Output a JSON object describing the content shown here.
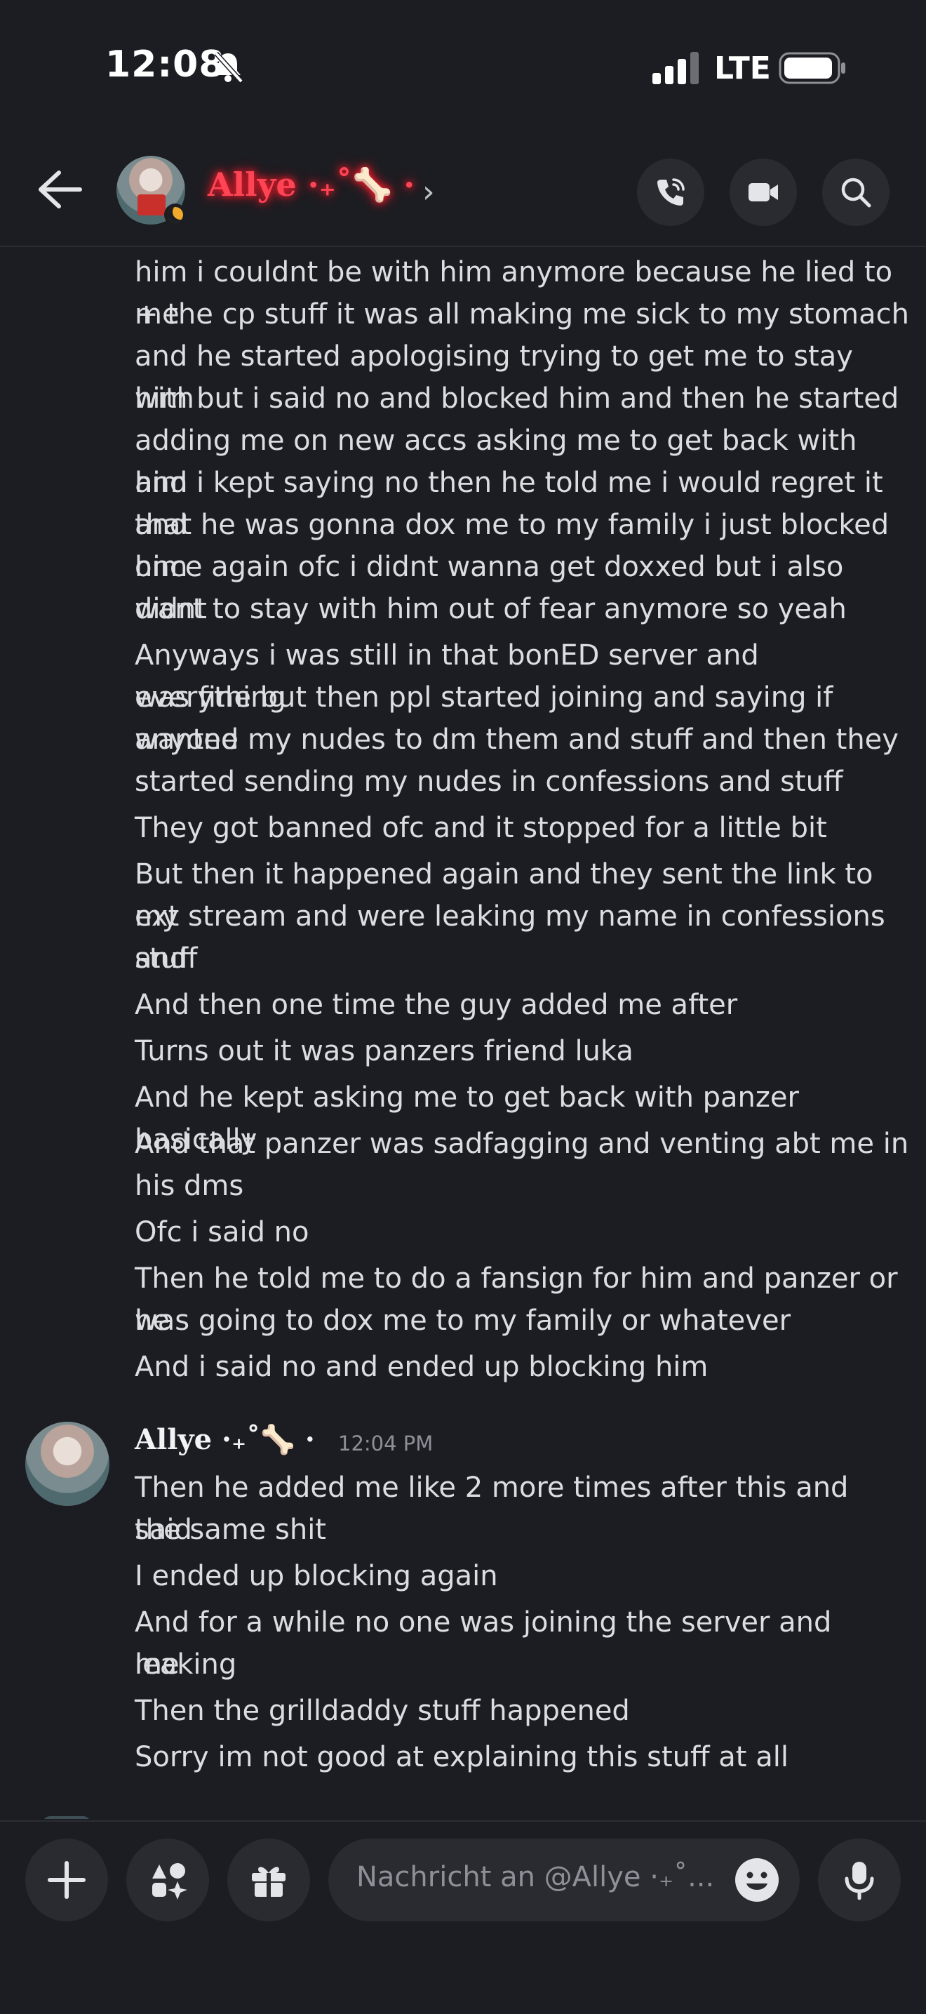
{
  "status_bar": {
    "time": "12:08",
    "network": "LTE"
  },
  "header": {
    "contact_name": "Allye ·₊˚🦴 ·"
  },
  "messages": {
    "continuation_lines": [
      "him i couldnt be with him anymore because he lied to me",
      "+ the cp stuff it was all making me sick to my stomach",
      "and he started apologising trying to get me to stay with",
      "him but i said no and blocked him and then he started",
      "adding me on new accs asking me to get back with him",
      "and i kept saying no then he told me i would regret it and",
      "that he was gonna dox me to my family i just blocked him",
      "once again ofc i didnt wanna get doxxed but i also didnt",
      "want to stay with him out of fear anymore so yeah",
      "Anyways i was still in that bonED server and everything",
      "was fine but then ppl started joining and saying if anyone",
      "wanted my nudes to dm them and stuff and then they",
      "started sending my nudes in confessions and stuff",
      "They got banned ofc and it stopped for a little bit",
      "But then it happened again and they sent the link to my",
      "ext stream and were leaking my name in confessions and",
      "stuff",
      "And then one time the guy added me after",
      "Turns out it was panzers friend luka",
      "And he kept asking me to get back with panzer basically",
      "And that panzer was sadfagging and venting abt me in",
      "his dms",
      "Ofc i said no",
      "Then he told me to do a fansign for him and panzer or he",
      "was going to dox me to my family or whatever",
      "And i said no and ended up blocking him"
    ],
    "group": {
      "author": "Allye ·₊˚🦴 ·",
      "timestamp": "12:04 PM",
      "lines": [
        "Then he added me like 2 more times after this and said",
        "the same shit",
        "I ended up blocking again",
        "And for a while no one was joining the server and leaking",
        "me",
        "Then the grilldaddy stuff happened",
        "Sorry im not good at explaining this stuff at all"
      ]
    }
  },
  "composer": {
    "placeholder": "Nachricht an @Allye ·₊˚..."
  }
}
